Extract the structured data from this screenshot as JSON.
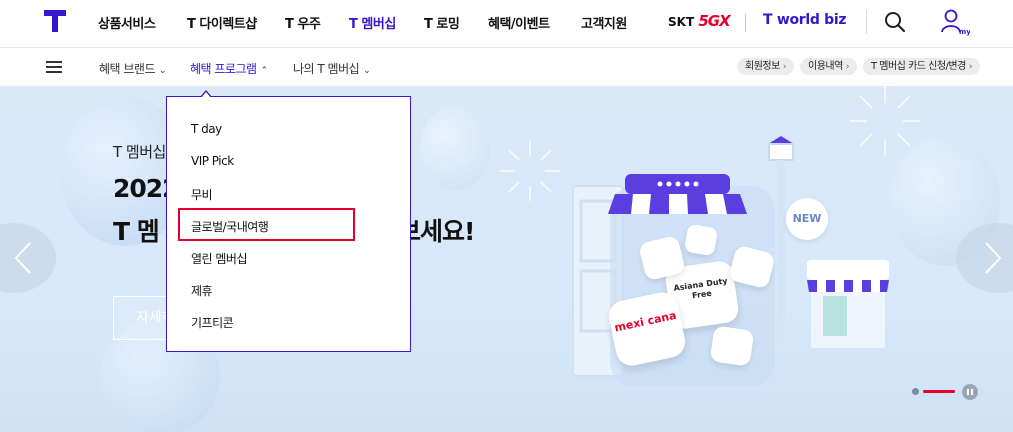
{
  "gnb": {
    "items": [
      {
        "label": "상품서비스"
      },
      {
        "label": "T 다이렉트샵"
      },
      {
        "label": "T 우주"
      },
      {
        "label": "T 멤버십"
      },
      {
        "label": "T 로밍"
      },
      {
        "label": "혜택/이벤트"
      },
      {
        "label": "고객지원"
      }
    ],
    "skt_prefix": "SKT",
    "skt_5gx": "5GX",
    "tworld": "T world biz",
    "myt_label": "myT",
    "accent": "#3617ce"
  },
  "lnb": {
    "items": [
      {
        "label": "혜택 브랜드"
      },
      {
        "label": "혜택 프로그램"
      },
      {
        "label": "나의 T 멤버십"
      }
    ],
    "pills": [
      {
        "label": "회원정보"
      },
      {
        "label": "이용내역"
      },
      {
        "label": "T 멤버십 카드 신청/변경"
      }
    ]
  },
  "hero": {
    "subtitle": "T 멤버십",
    "title_line1": "2022",
    "title_line2_start": "T 멤",
    "title_line2_end": "보세요!",
    "detail_button": "자세히",
    "store_badge": "NEW",
    "card_labels": [
      "Asiana Duty Free",
      "mexi cana"
    ]
  },
  "dropdown": {
    "items": [
      {
        "label": "T day"
      },
      {
        "label": "VIP Pick"
      },
      {
        "label": "무비"
      },
      {
        "label": "글로벌/국내여행"
      },
      {
        "label": "열린 멤버십"
      },
      {
        "label": "제휴"
      },
      {
        "label": "기프티콘"
      }
    ],
    "highlighted_index": 3,
    "highlight_color": "#e4002b"
  }
}
